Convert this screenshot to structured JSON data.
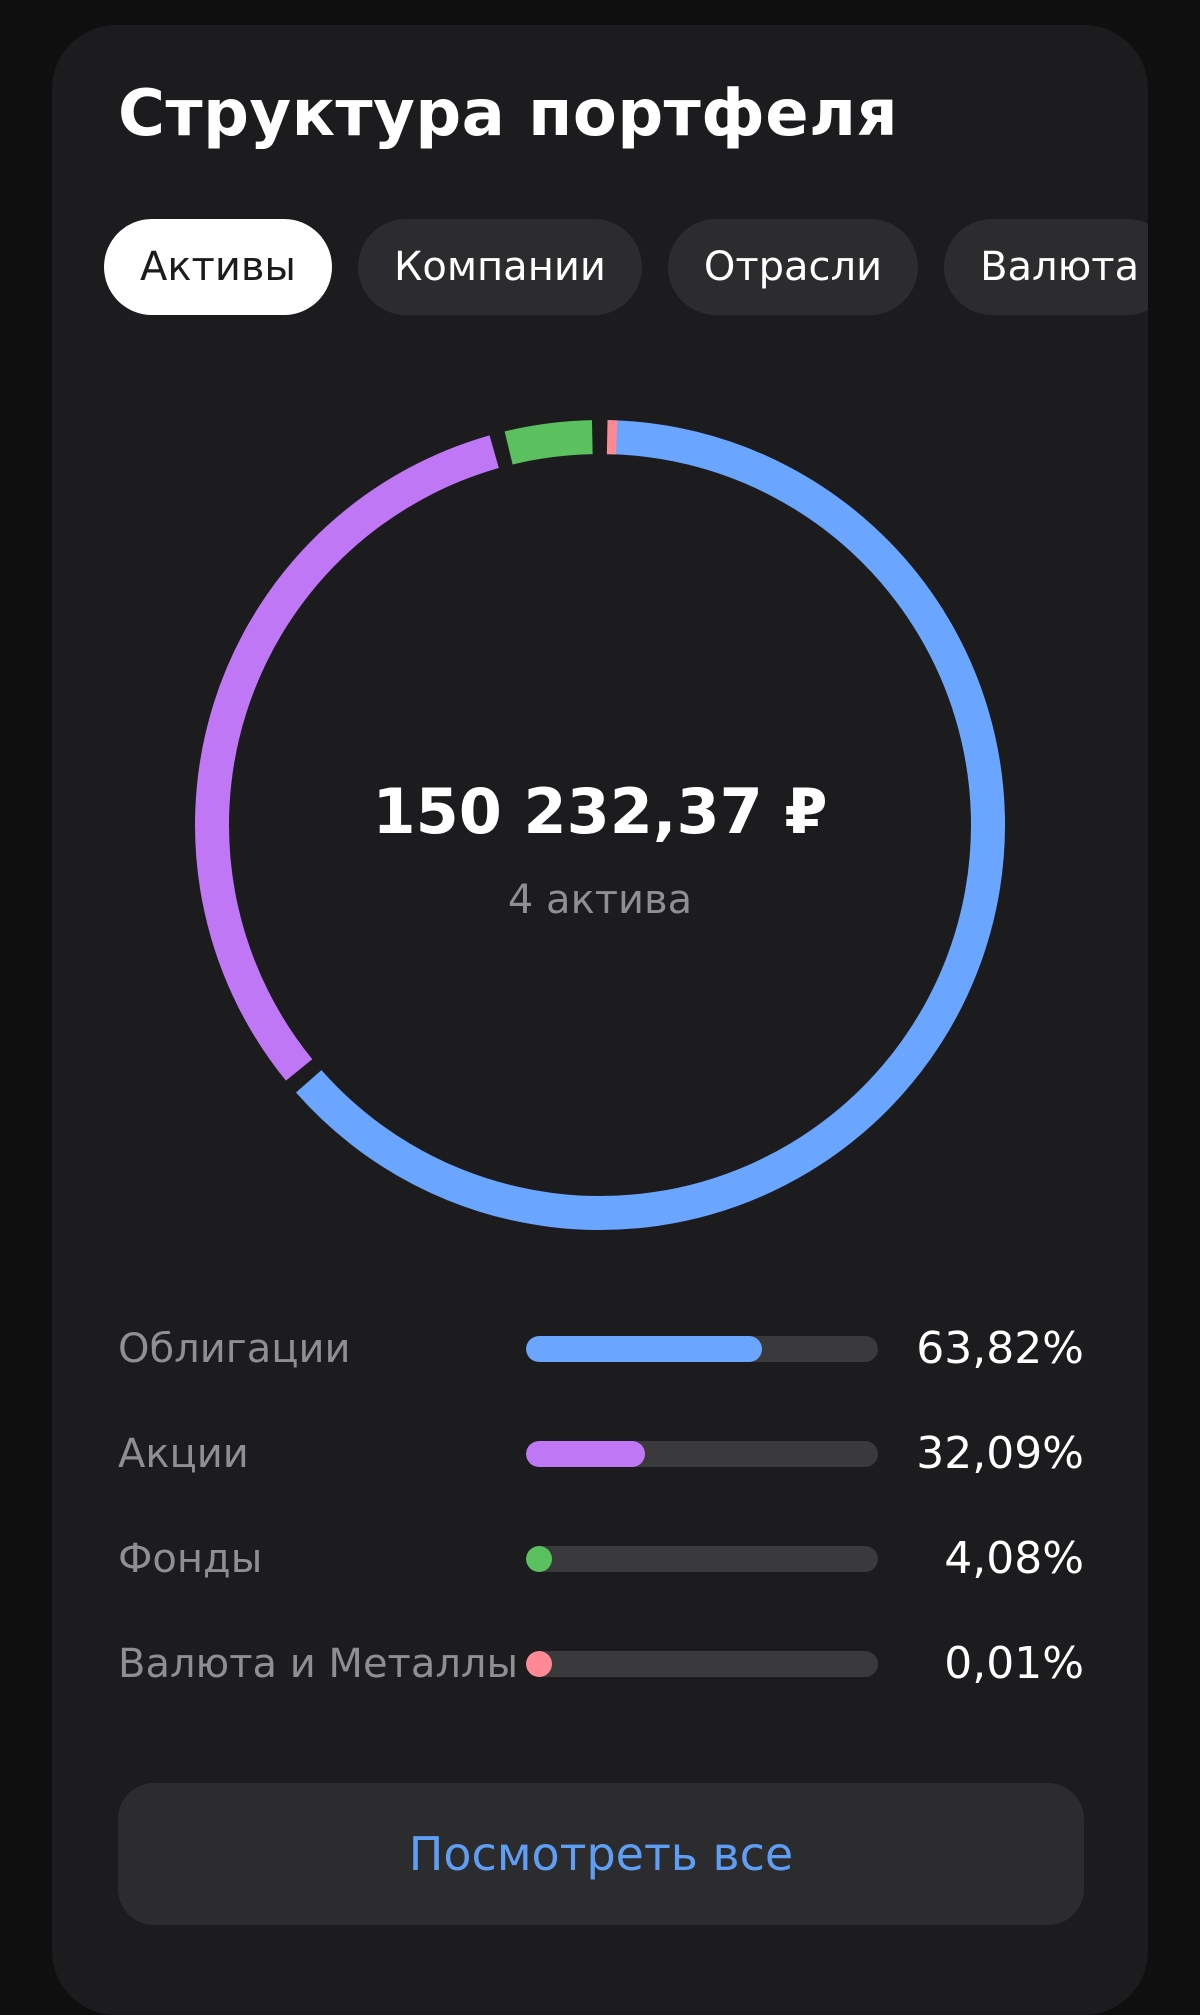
{
  "header": {
    "title": "Структура портфеля"
  },
  "tabs": [
    {
      "label": "Активы",
      "active": true
    },
    {
      "label": "Компании",
      "active": false
    },
    {
      "label": "Отрасли",
      "active": false
    },
    {
      "label": "Валюта",
      "active": false
    }
  ],
  "summary": {
    "total": "150 232,37 ₽",
    "count_label": "4 актива"
  },
  "chart_data": {
    "type": "pie",
    "categories": [
      "Облигации",
      "Акции",
      "Фонды",
      "Валюта и Металлы"
    ],
    "values": [
      63.82,
      32.09,
      4.08,
      0.01
    ],
    "value_labels": [
      "63,82%",
      "32,09%",
      "4,08%",
      "0,01%"
    ],
    "colors": [
      "#6aa6ff",
      "#bf77f6",
      "#5ac15e",
      "#ff8a95"
    ]
  },
  "actions": {
    "view_all_label": "Посмотреть все"
  }
}
